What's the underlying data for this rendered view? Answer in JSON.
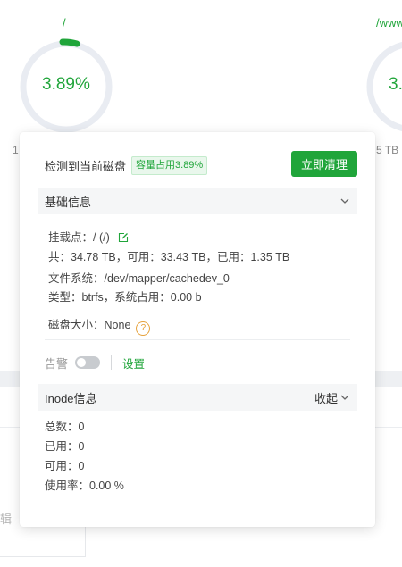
{
  "background": {
    "disk_left": {
      "path": "/",
      "percent_text": "3.89%",
      "percent": 3.89,
      "below_text": "1"
    },
    "disk_right": {
      "path": "/www",
      "percent_text": "3.",
      "below_text": "5 TB"
    },
    "edit_partial": "辑"
  },
  "popover": {
    "title": "检测到当前磁盘",
    "badge": "容量占用3.89%",
    "clean_button": "立即清理",
    "basic_section": {
      "title": "基础信息",
      "mount_label": "挂载点：",
      "mount_value": "/ (/)",
      "capacity_line": "共：34.78 TB，可用：33.43 TB，已用：1.35 TB",
      "fs_label": "文件系统：",
      "fs_value": "/dev/mapper/cachedev_0",
      "type_line": "类型：btrfs，系统占用：0.00 b",
      "size_label": "磁盘大小：",
      "size_value": "None"
    },
    "alert_label": "告警",
    "alert_enabled": false,
    "settings_link": "设置",
    "inode_section": {
      "title": "Inode信息",
      "collapse_label": "收起",
      "total_line": "总数：0",
      "used_line": "已用：0",
      "available_line": "可用：0",
      "usage_line": "使用率：0.00 %"
    }
  },
  "colors": {
    "accent": "#20a53a",
    "warning": "#e6a23c",
    "ring_track": "#e9ecf2"
  }
}
